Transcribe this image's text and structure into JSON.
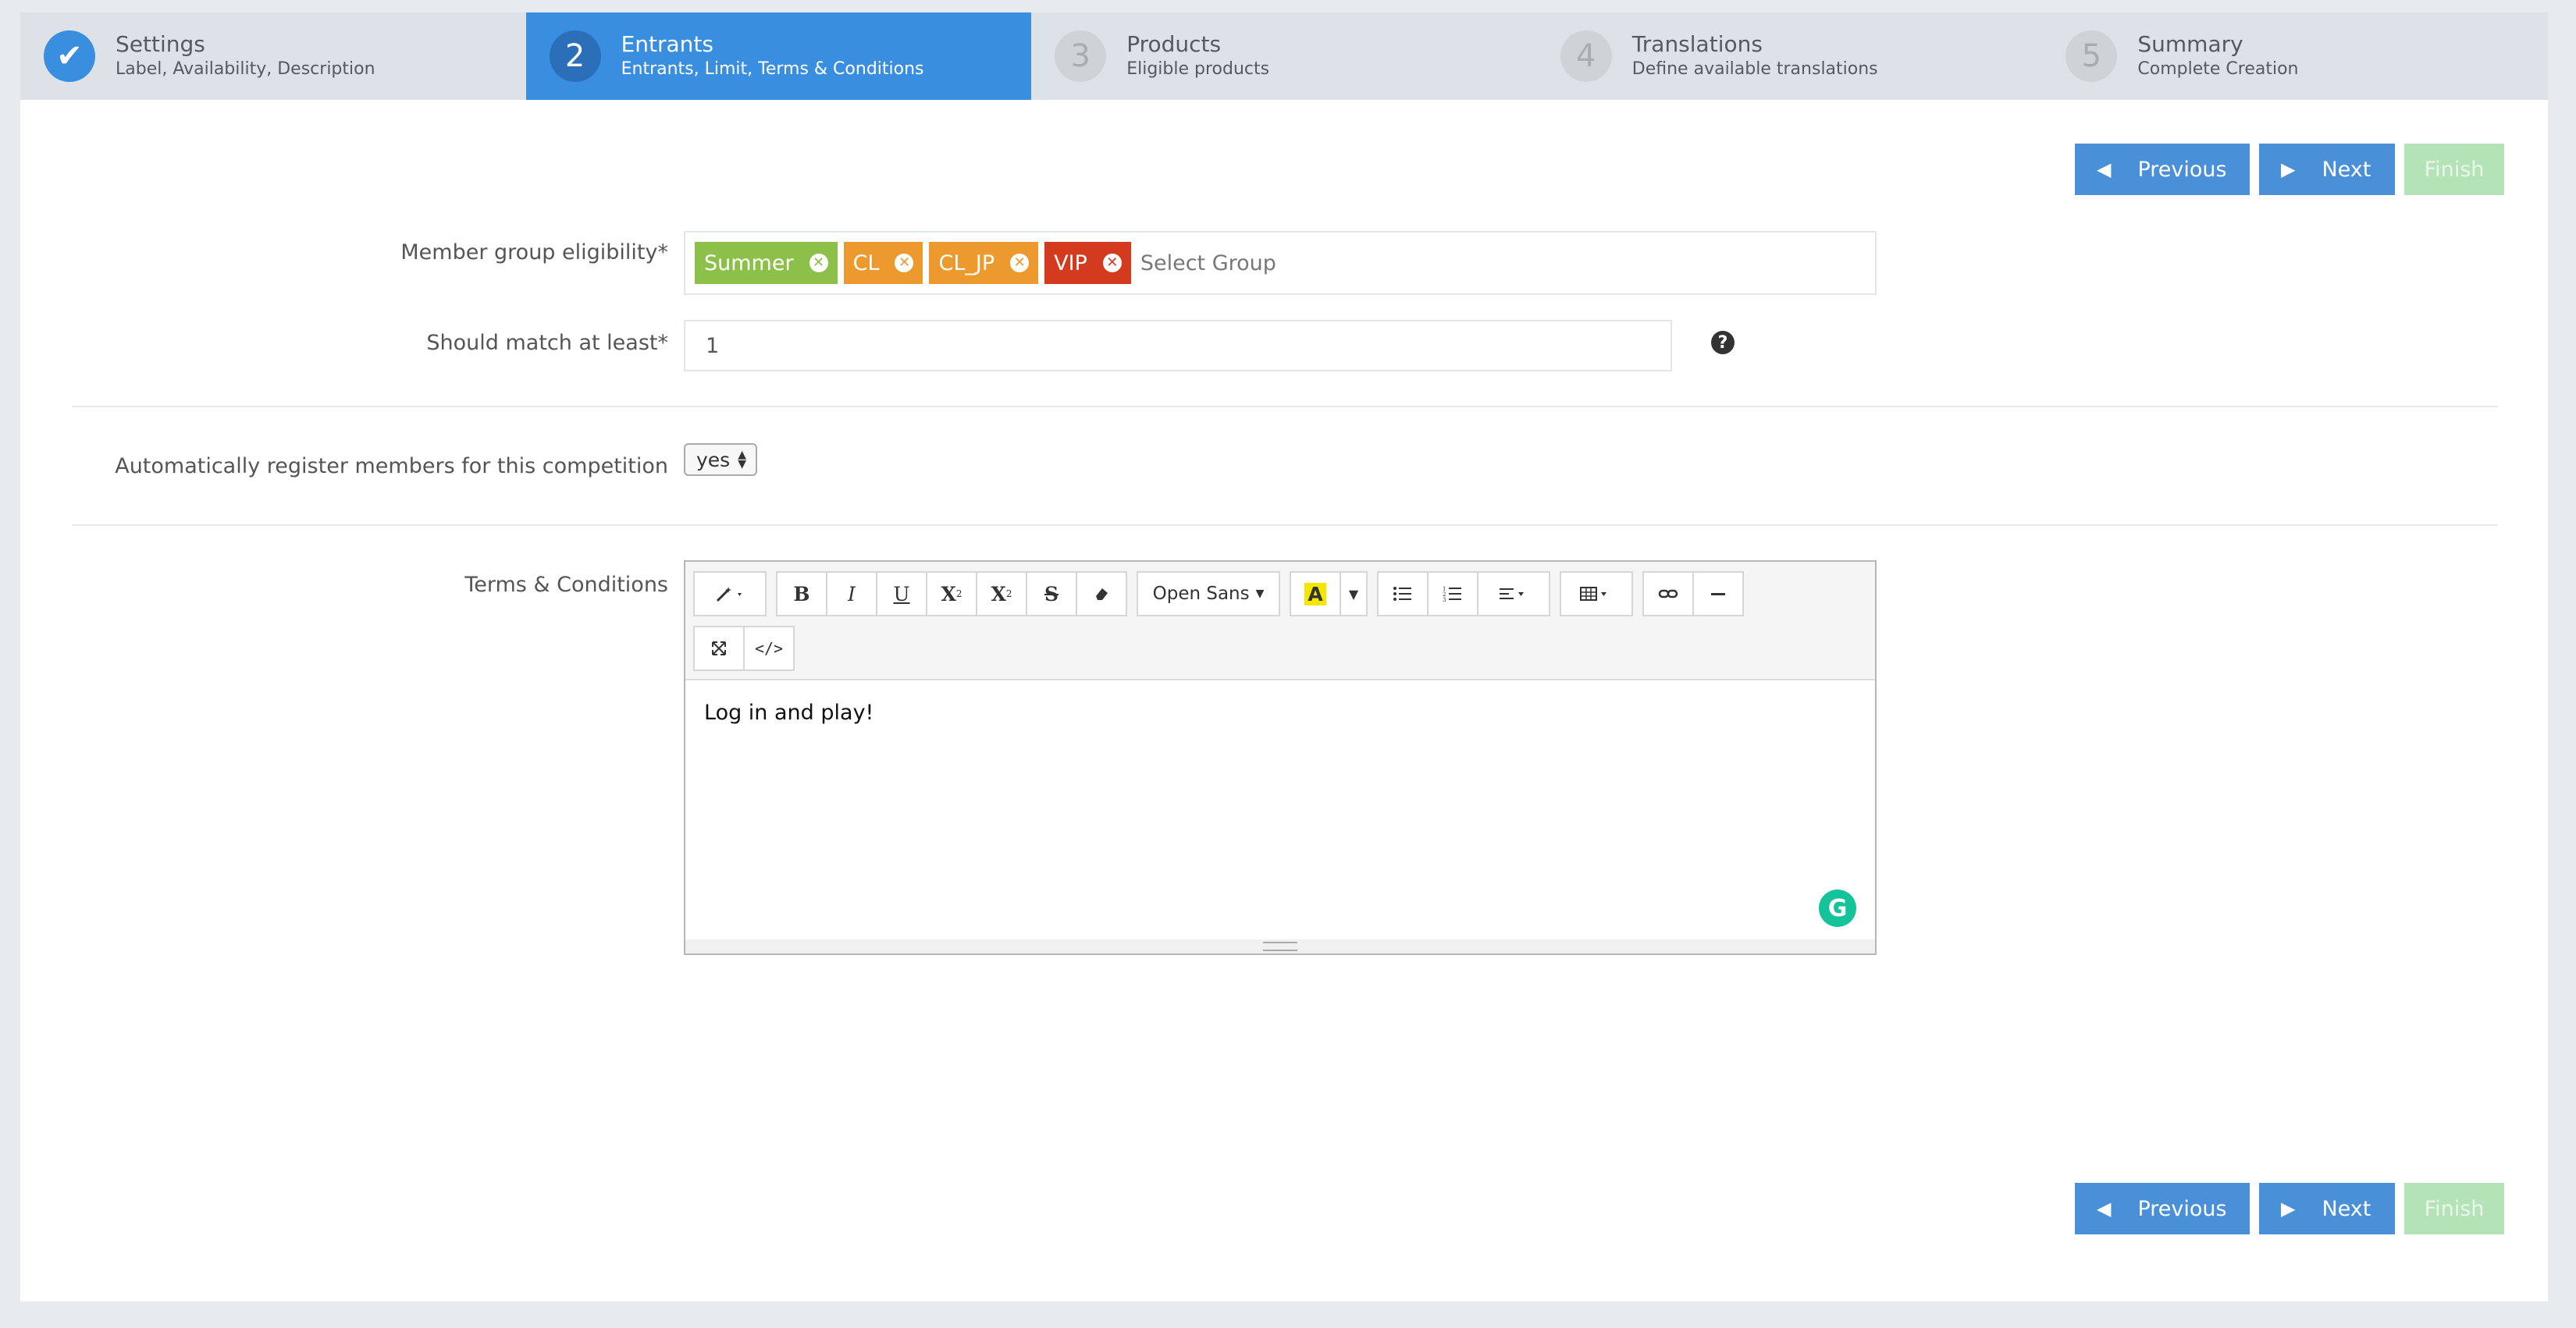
{
  "steps": [
    {
      "num": "✔",
      "title": "Settings",
      "sub": "Label, Availability, Description"
    },
    {
      "num": "2",
      "title": "Entrants",
      "sub": "Entrants, Limit, Terms & Conditions"
    },
    {
      "num": "3",
      "title": "Products",
      "sub": "Eligible products"
    },
    {
      "num": "4",
      "title": "Translations",
      "sub": "Define available translations"
    },
    {
      "num": "5",
      "title": "Summary",
      "sub": "Complete Creation"
    }
  ],
  "nav": {
    "previous": "Previous",
    "next": "Next",
    "finish": "Finish",
    "prev_icon": "◀",
    "next_icon": "▶"
  },
  "form": {
    "member_group_label": "Member group eligibility*",
    "tags": [
      {
        "label": "Summer",
        "color": "#8cc048"
      },
      {
        "label": "CL",
        "color": "#ec9a2e"
      },
      {
        "label": "CL_JP",
        "color": "#ec9a2e"
      },
      {
        "label": "VIP",
        "color": "#d43a1e"
      }
    ],
    "tag_remove_icon": "✕",
    "group_placeholder": "Select Group",
    "match_label": "Should match at least*",
    "match_value": "1",
    "help_icon": "?",
    "auto_register_label": "Automatically register members for this competition",
    "auto_register_value": "yes",
    "terms_label": "Terms & Conditions"
  },
  "editor": {
    "font_name": "Open Sans",
    "content": "Log in and play!",
    "grammarly_icon": "G"
  }
}
